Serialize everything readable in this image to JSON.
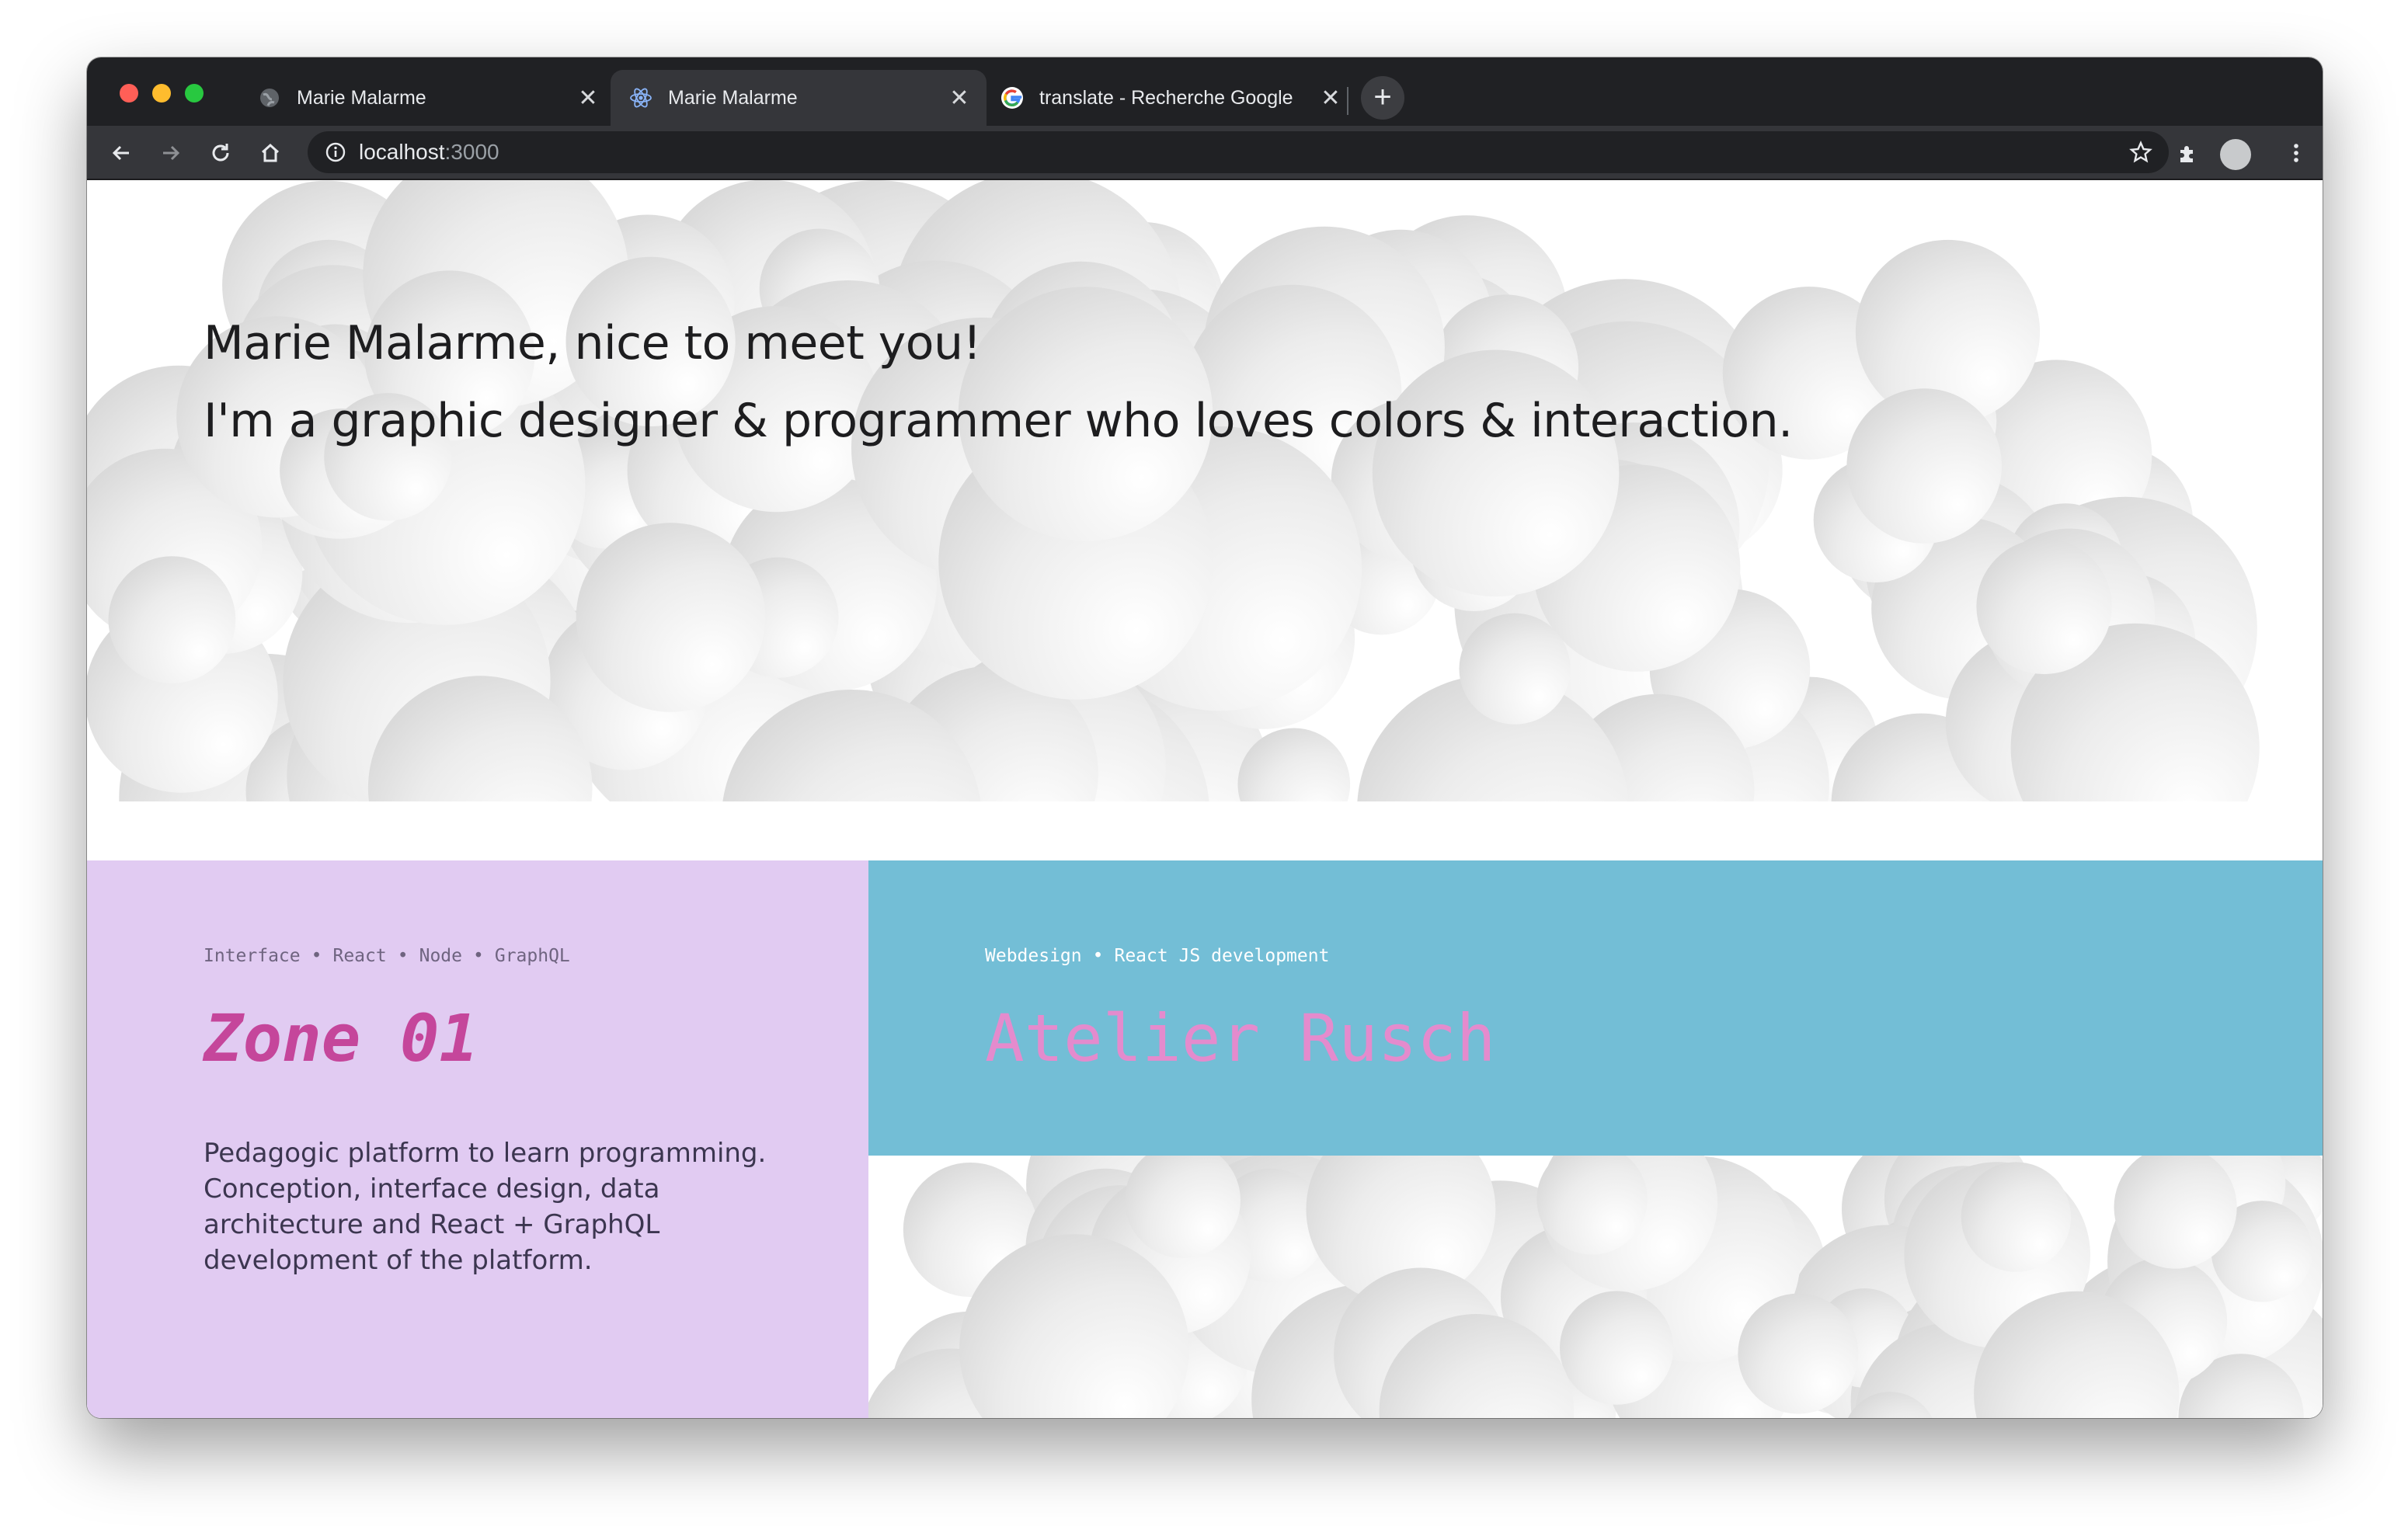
{
  "browser": {
    "tabs": [
      {
        "title": "Marie Malarme",
        "icon": "globe-icon",
        "active": false
      },
      {
        "title": "Marie Malarme",
        "icon": "react-icon",
        "active": true
      },
      {
        "title": "translate - Recherche Google",
        "icon": "google-icon",
        "active": false
      }
    ],
    "tab_close_glyph": "✕",
    "new_tab_glyph": "+",
    "address": {
      "host": "localhost",
      "port": ":3000"
    }
  },
  "hero": {
    "line1": "Marie Malarme, nice to meet you!",
    "line2": "I'm a graphic designer & programmer who loves colors & interaction."
  },
  "projects": [
    {
      "tags": [
        "Interface",
        "React",
        "Node",
        "GraphQL"
      ],
      "title": "Zone 01",
      "description": "Pedagogic platform to learn programming. Conception, interface design, data architecture and React + GraphQL development of the platform.",
      "background": "#e1cbf2",
      "title_color": "#c5469b"
    },
    {
      "tags": [
        "Webdesign",
        "React JS development"
      ],
      "title": "Atelier Rusch",
      "background": "#73bed6",
      "title_color": "#e48bcd"
    }
  ],
  "tag_separator": "•",
  "strips": {
    "red": "#e33330",
    "lilac": "#e1cbf2"
  }
}
